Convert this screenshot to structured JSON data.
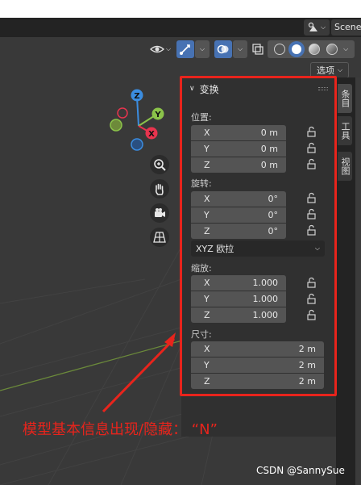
{
  "topbar": {
    "scene_label": "Scene"
  },
  "viewport_header": {
    "options_label": "选项"
  },
  "gizmo": {
    "x": "X",
    "y": "Y",
    "z": "Z"
  },
  "panel": {
    "title": "变换",
    "location": {
      "label": "位置:",
      "x_label": "X",
      "x": "0 m",
      "y_label": "Y",
      "y": "0 m",
      "z_label": "Z",
      "z": "0 m"
    },
    "rotation": {
      "label": "旋转:",
      "x_label": "X",
      "x": "0°",
      "y_label": "Y",
      "y": "0°",
      "z_label": "Z",
      "z": "0°",
      "mode": "XYZ 欧拉"
    },
    "scale": {
      "label": "缩放:",
      "x_label": "X",
      "x": "1.000",
      "y_label": "Y",
      "y": "1.000",
      "z_label": "Z",
      "z": "1.000"
    },
    "dimensions": {
      "label": "尺寸:",
      "x_label": "X",
      "x": "2 m",
      "y_label": "Y",
      "y": "2 m",
      "z_label": "Z",
      "z": "2 m"
    }
  },
  "tabs": {
    "item": "条目",
    "tool": "工具",
    "view": "视图"
  },
  "annotation": {
    "text": "模型基本信息出现/隐藏：   “N”"
  },
  "watermark": "CSDN @SannySue",
  "colors": {
    "accent_red": "#e8241c",
    "axis_x": "#e8344e",
    "axis_y": "#8bc34a",
    "axis_z": "#3b8de0"
  }
}
